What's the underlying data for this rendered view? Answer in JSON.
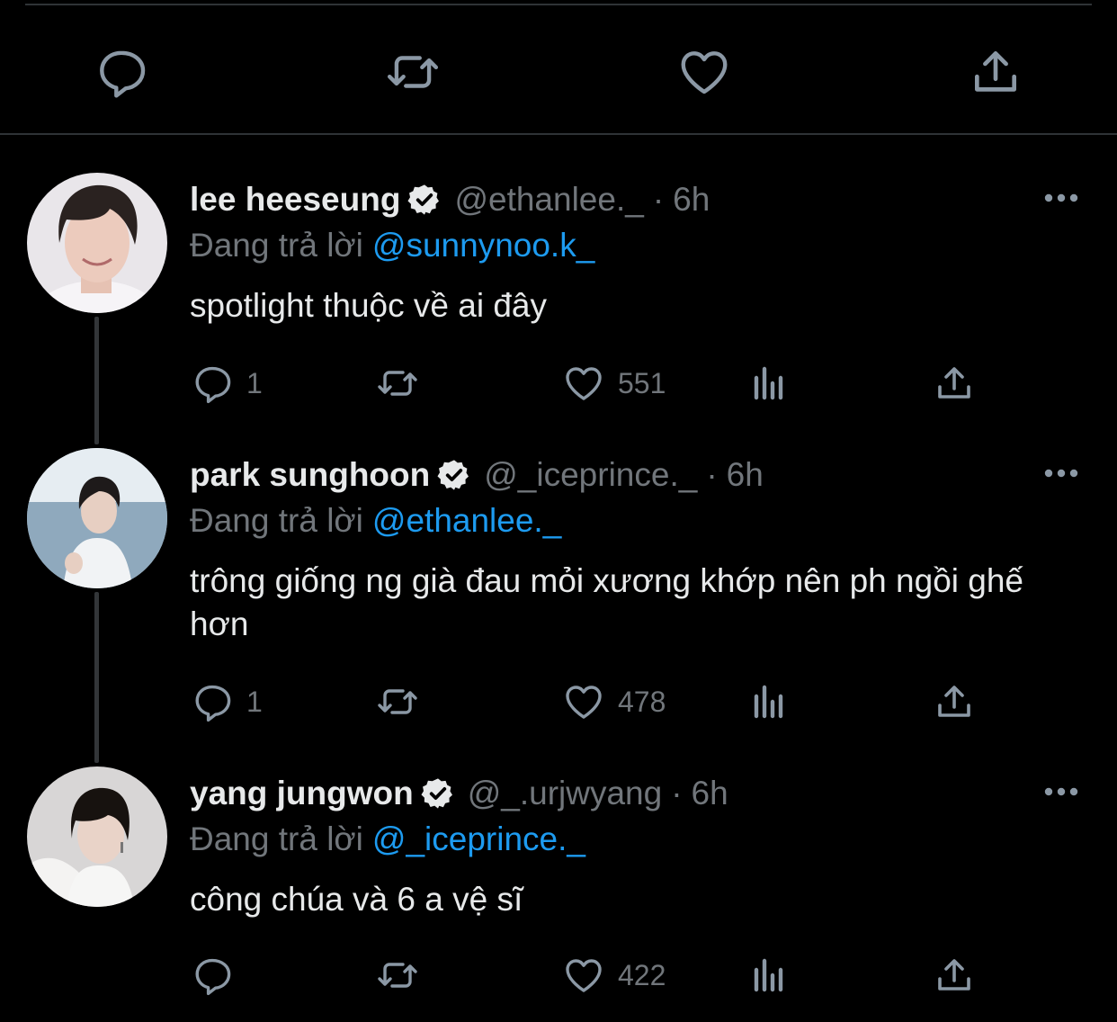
{
  "colors": {
    "background": "#000000",
    "text_primary": "#e7e9ea",
    "text_secondary": "#71767b",
    "link": "#1d9bf0",
    "divider": "#2f3336",
    "icon": "#8b98a5"
  },
  "top_actions": {
    "icons": [
      "reply-icon",
      "retweet-icon",
      "like-icon",
      "share-icon"
    ]
  },
  "tweets": [
    {
      "name": "lee heeseung",
      "handle": "@ethanlee._",
      "separator": "·",
      "time": "6h",
      "reply_prefix": "Đang trả lời",
      "reply_to": "@sunnynoo.k_",
      "text": "spotlight thuộc về ai đây",
      "replies": "1",
      "retweets": "",
      "likes": "551"
    },
    {
      "name": "park sunghoon",
      "handle": "@_iceprince._",
      "separator": "·",
      "time": "6h",
      "reply_prefix": "Đang trả lời",
      "reply_to": "@ethanlee._",
      "text": "trông giống ng già đau mỏi xương khớp nên ph ngồi ghế hơn",
      "replies": "1",
      "retweets": "",
      "likes": "478"
    },
    {
      "name": "yang jungwon",
      "handle": "@_.urjwyang",
      "separator": "·",
      "time": "6h",
      "reply_prefix": "Đang trả lời",
      "reply_to": "@_iceprince._",
      "text": "công chúa và 6 a vệ sĩ",
      "replies": "",
      "retweets": "",
      "likes": "422"
    }
  ]
}
